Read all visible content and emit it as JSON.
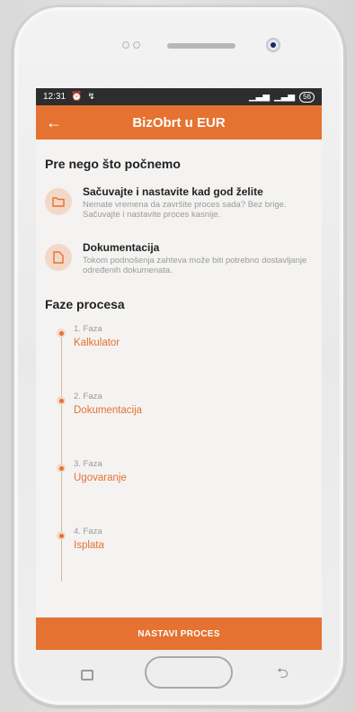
{
  "status": {
    "time": "12:31",
    "battery": "56"
  },
  "appbar": {
    "title": "BizObrt u EUR",
    "back_icon": "arrow-left-icon"
  },
  "intro": {
    "heading": "Pre nego što počnemo",
    "items": [
      {
        "icon": "folder-icon",
        "title": "Sačuvajte i nastavite kad god želite",
        "desc": "Nemate vremena da završite proces sada? Bez brige. Sačuvajte i nastavite proces kasnije."
      },
      {
        "icon": "document-icon",
        "title": "Dokumentacija",
        "desc": "Tokom podnošenja zahteva može biti potrebno dostavljanje određenih dokumenata."
      }
    ]
  },
  "phases": {
    "heading": "Faze procesa",
    "steps": [
      {
        "num": "1. Faza",
        "label": "Kalkulator"
      },
      {
        "num": "2. Faza",
        "label": "Dokumentacija"
      },
      {
        "num": "3. Faza",
        "label": "Ugovaranje"
      },
      {
        "num": "4. Faza",
        "label": "Isplata"
      }
    ]
  },
  "cta": {
    "label": "NASTAVI PROCES"
  },
  "colors": {
    "accent": "#e57230",
    "accent_soft": "#f3d8c8"
  }
}
